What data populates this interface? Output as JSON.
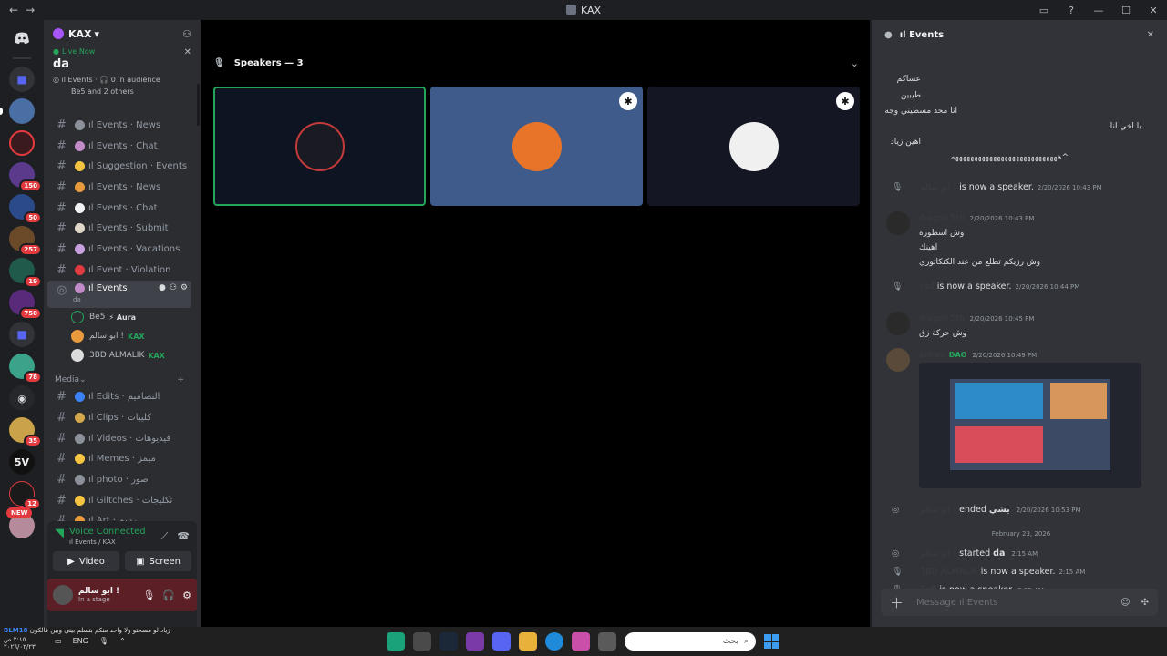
{
  "window": {
    "title": "KAX"
  },
  "server": {
    "name": "KAX"
  },
  "live_now": {
    "label": "Live Now",
    "stage_name": "da",
    "channel": "ıl Events",
    "audience": "0 in audience",
    "speakers_summary": "Be5 and 2 others"
  },
  "channels": [
    {
      "name": "ıl Events · News",
      "emoji_color": "#8c9099"
    },
    {
      "name": "ıl Events · Chat",
      "emoji_color": "#c18ac9"
    },
    {
      "name": "ıl Suggestion · Events",
      "emoji_color": "#f5c542"
    },
    {
      "name": "ıl Events · News",
      "emoji_color": "#e89a3c"
    },
    {
      "name": "ıl Events · Chat",
      "emoji_color": "#f2f3f5"
    },
    {
      "name": "ıl Events · Submit",
      "emoji_color": "#e0d8c8"
    },
    {
      "name": "ıl Events · Vacations",
      "emoji_color": "#c9a0e0"
    },
    {
      "name": "ıl Event · Violation",
      "emoji_color": "#e23b3f"
    }
  ],
  "active_stage": {
    "name": "ıl Events",
    "topic": "da",
    "users": [
      {
        "name": "Be5",
        "tag": "⚡ Aura",
        "avatar": "#2b2d31"
      },
      {
        "name": "ابو سالم !",
        "tag": "KAX",
        "avatar": "#e89a3c"
      },
      {
        "name": "3BD ALMALIK",
        "tag": "KAX",
        "avatar": "#dcdcdc"
      }
    ]
  },
  "media_category": {
    "label": "Media",
    "channels": [
      {
        "name": "ıl Edits · التصاميم",
        "emoji_color": "#3b82f6"
      },
      {
        "name": "ıl Clips · كليبات",
        "emoji_color": "#d4a84b"
      },
      {
        "name": "ıl Videos · فيديوهات",
        "emoji_color": "#8c9099"
      },
      {
        "name": "ıl Memes · ميمز",
        "emoji_color": "#f5c542"
      },
      {
        "name": "ıl photo · صور",
        "emoji_color": "#8c9099"
      },
      {
        "name": "ıl Giltches · تكليجات",
        "emoji_color": "#f5c542"
      },
      {
        "name": "ıl Art · رسم",
        "emoji_color": "#e89a3c"
      }
    ]
  },
  "voice_panel": {
    "status": "Voice Connected",
    "location": "ıl Events / KAX",
    "video_label": "Video",
    "screen_label": "Screen",
    "user_name": "ابو سالم !",
    "user_status": "In a stage"
  },
  "stage_view": {
    "header": "Speakers — 3",
    "tiles": [
      {
        "bg": "#0f1422",
        "face": "#1a1a22",
        "speaking": true,
        "star": false
      },
      {
        "bg": "#3e5b8c",
        "face": "#e8742a",
        "speaking": false,
        "star": true
      },
      {
        "bg": "#141624",
        "face": "#f0f0f0",
        "speaking": false,
        "star": true
      }
    ]
  },
  "chat": {
    "title": "ıl Events",
    "lines": [
      "عساكم",
      "طيبين",
      "انا محد مسطيني وجه",
      "يا اخي انا",
      "اهين زياد",
      "^ههههههههههههههههههههههههههههه"
    ],
    "events": [
      {
        "name": "ابو سالم !",
        "text": "is now a speaker.",
        "ts": "2/20/2026 10:43 PM"
      },
      {
        "name": "rad",
        "text": "is now a speaker.",
        "ts": "2/20/2026 10:44 PM"
      },
      {
        "name": "ابو سالم !",
        "text": "ended",
        "bold": "يشي",
        "ts": "2/20/2026 10:53 PM"
      }
    ],
    "messages": [
      {
        "name": "dragon 5th",
        "ts": "2/20/2026 10:43 PM",
        "lines": [
          "وش اسطورة",
          "اهينك",
          "وش رزيكم تطلع من عند الكنكاتوري"
        ]
      },
      {
        "name": "dragon 5th",
        "ts": "2/20/2026 10:45 PM",
        "lines": [
          "وش حركة زق"
        ]
      },
      {
        "name": "ashwa",
        "role": "DAO",
        "ts": "2/20/2026 10:49 PM",
        "lines": []
      }
    ],
    "date_divider": "February 23, 2026",
    "later_events": [
      {
        "name": "ابو سالم !",
        "text": "started",
        "bold": "da",
        "ts": "2:15 AM"
      },
      {
        "name": "3BD ALMALIK",
        "text": "is now a speaker.",
        "ts": "2:15 AM"
      },
      {
        "name": "Be5",
        "text": "is now a speaker.",
        "ts": "2:15 AM"
      }
    ],
    "compose_placeholder": "Message ıl Events"
  },
  "guild_badges": [
    "150",
    "50",
    "257",
    "19",
    "750",
    "78",
    "35",
    "12"
  ],
  "guild_new": "NEW",
  "taskbar": {
    "ticker": "زياد لو مسحتو ولا واحد منكم بتسلم بيني وبين فالكون",
    "ticker_prefix": "BLM18",
    "time": "٢:١٥ ص",
    "date": "٢٠٢٦/٠٢/٢٣",
    "lang": "ENG",
    "search_placeholder": "بحث"
  }
}
